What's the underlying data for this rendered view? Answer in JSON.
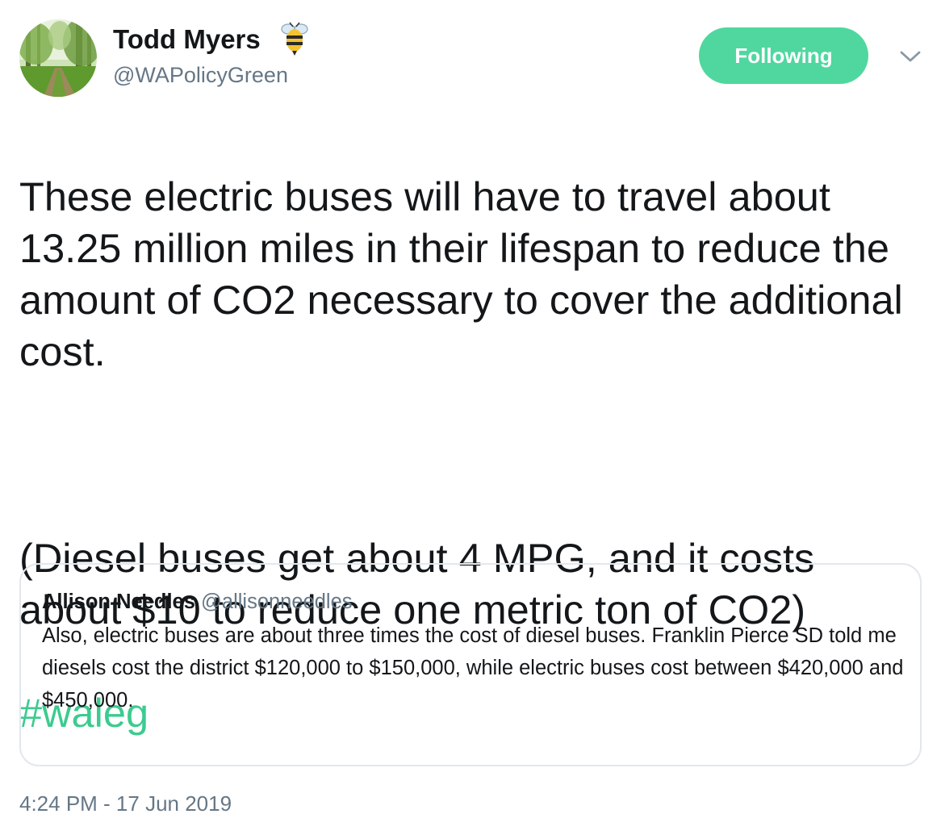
{
  "author": {
    "name": "Todd Myers",
    "handle": "@WAPolicyGreen",
    "emoji_icon": "bee-icon"
  },
  "follow_button": {
    "label": "Following",
    "color": "#4fd79f"
  },
  "menu_icon": "chevron-down-icon",
  "tweet": {
    "paragraph_1": "These electric buses will have to travel about 13.25 million miles in their lifespan to reduce the amount of CO2 necessary to cover the additional cost.",
    "paragraph_2": "(Diesel buses get about 4 MPG, and it costs about $10 to reduce one metric ton of CO2)",
    "hashtag": "#waleg",
    "hashtag_color": "#3ccb8f"
  },
  "quoted_tweet": {
    "name": "Allison Needles",
    "handle": "@allisonneedles",
    "text": "Also, electric buses are about three times the cost of diesel buses. Franklin Pierce SD told me diesels cost the district $120,000 to $150,000, while electric buses cost between $420,000 and $450,000."
  },
  "timestamp": "4:24 PM - 17 Jun 2019"
}
